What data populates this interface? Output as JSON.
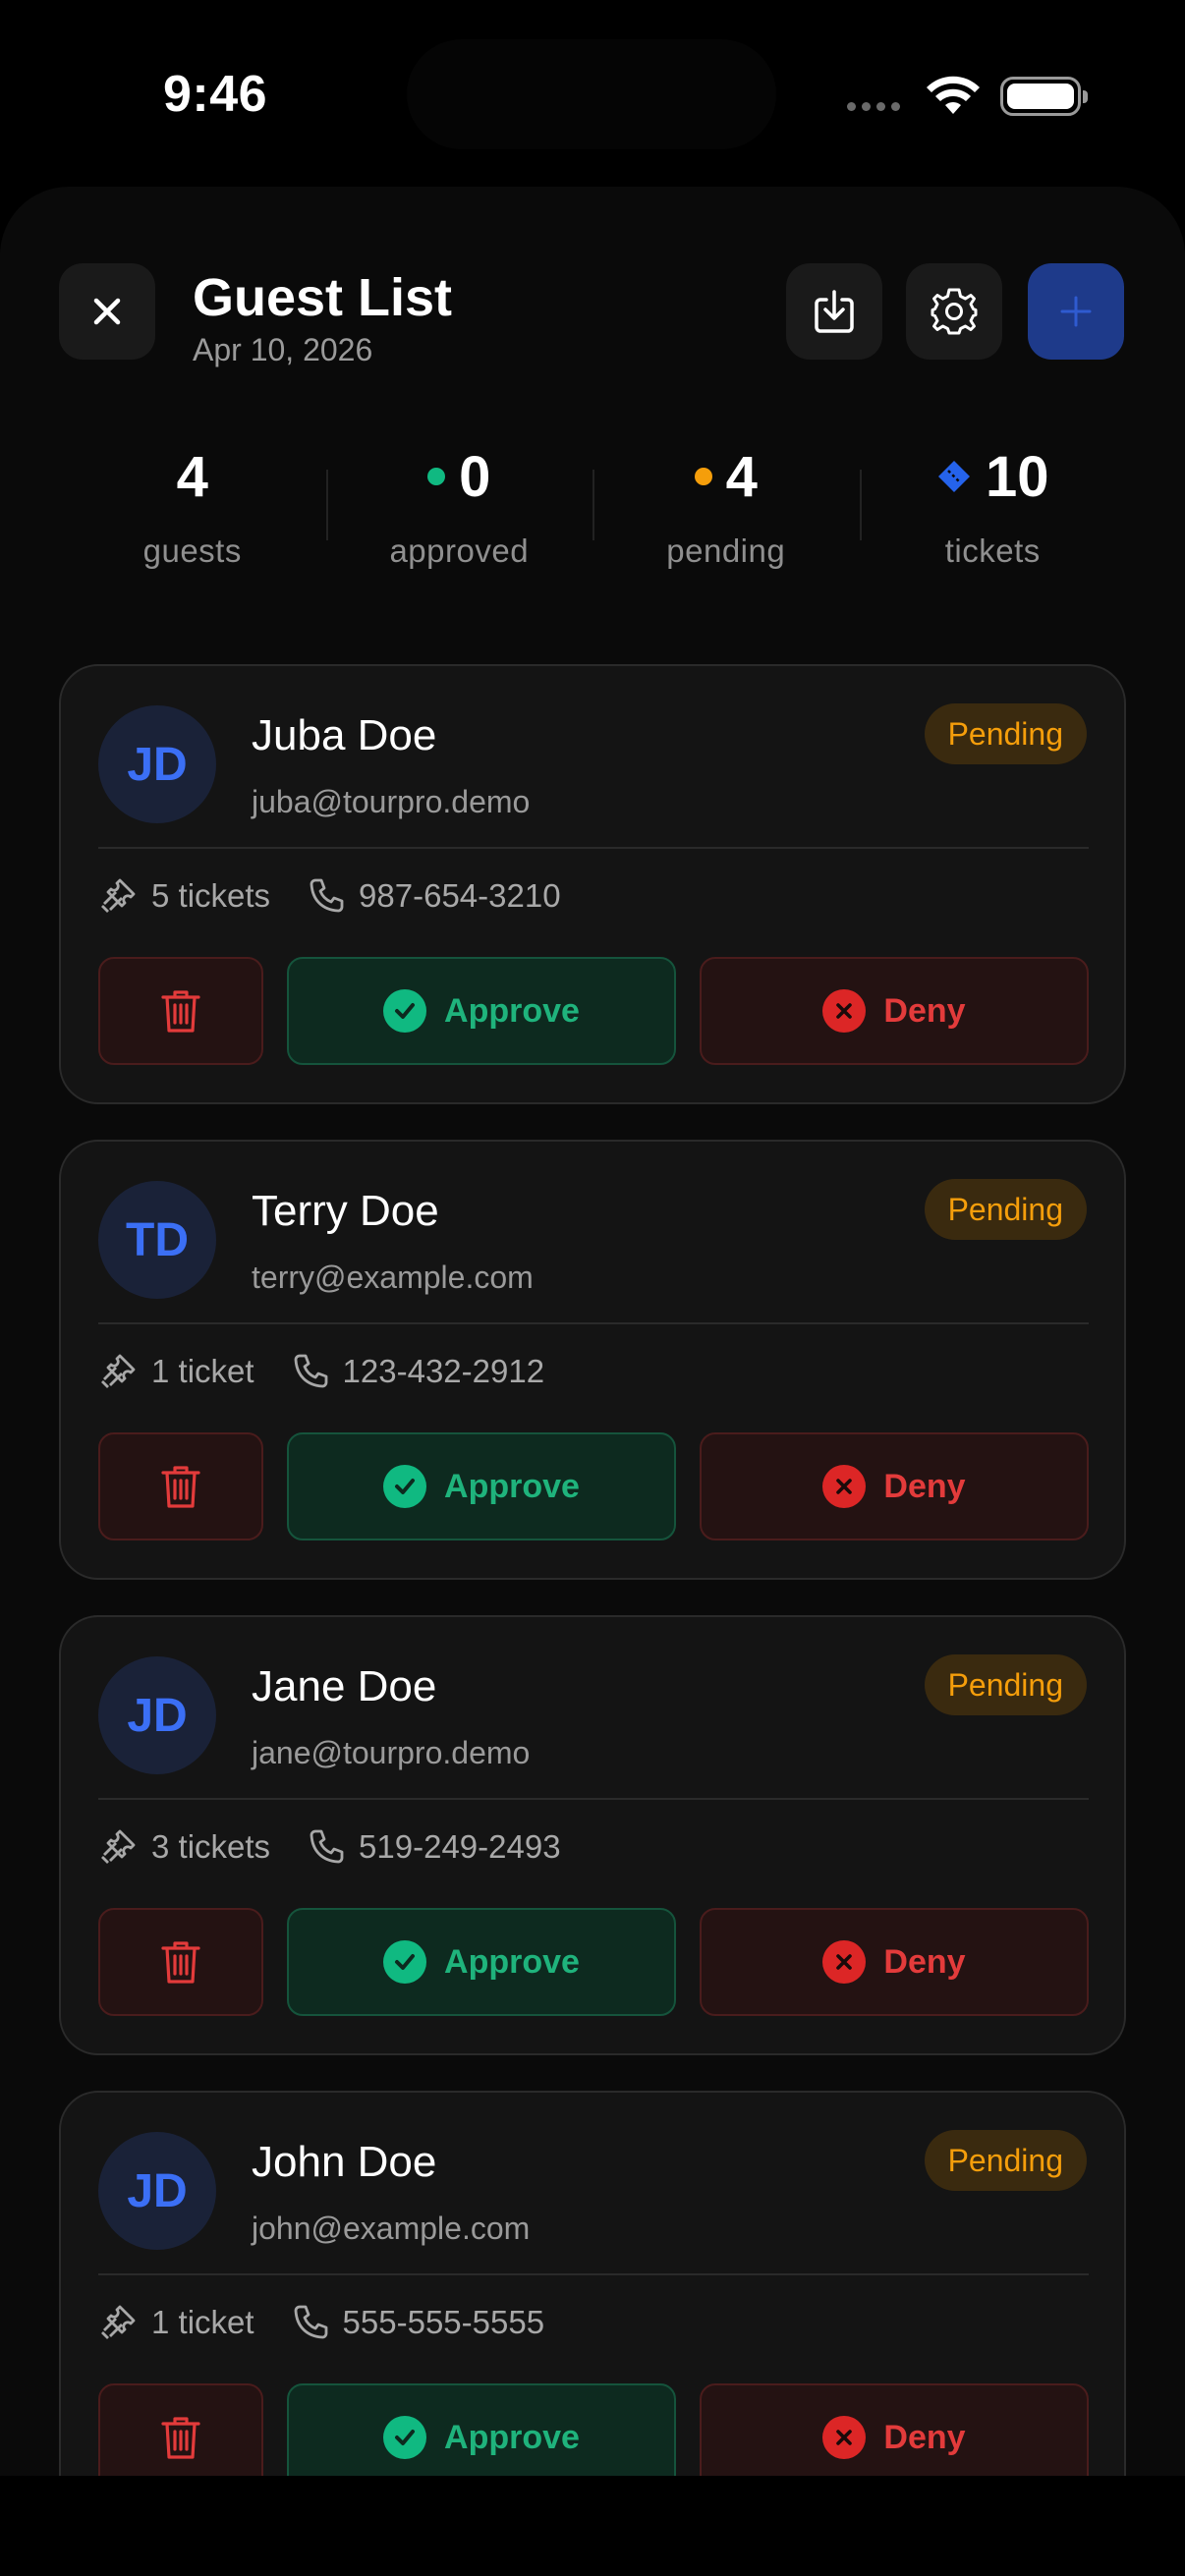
{
  "status_bar": {
    "time": "9:46"
  },
  "header": {
    "title": "Guest List",
    "date": "Apr 10, 2026",
    "close_icon": "close-icon",
    "export_icon": "download-icon",
    "settings_icon": "gear-icon",
    "add_icon": "plus-icon"
  },
  "stats": {
    "guests": {
      "value": "4",
      "label": "guests"
    },
    "approved": {
      "value": "0",
      "label": "approved",
      "color": "#10b981"
    },
    "pending": {
      "value": "4",
      "label": "pending",
      "color": "#f59e0b"
    },
    "tickets": {
      "value": "10",
      "label": "tickets",
      "color": "#2563eb"
    }
  },
  "actions": {
    "approve": "Approve",
    "deny": "Deny"
  },
  "guests": [
    {
      "initials": "JD",
      "name": "Juba Doe",
      "email": "juba@tourpro.demo",
      "status": "Pending",
      "tickets": "5 tickets",
      "phone": "987-654-3210"
    },
    {
      "initials": "TD",
      "name": "Terry Doe",
      "email": "terry@example.com",
      "status": "Pending",
      "tickets": "1 ticket",
      "phone": "123-432-2912"
    },
    {
      "initials": "JD",
      "name": "Jane Doe",
      "email": "jane@tourpro.demo",
      "status": "Pending",
      "tickets": "3 tickets",
      "phone": "519-249-2493"
    },
    {
      "initials": "JD",
      "name": "John Doe",
      "email": "john@example.com",
      "status": "Pending",
      "tickets": "1 ticket",
      "phone": "555-555-5555"
    }
  ],
  "colors": {
    "accent": "#2563eb",
    "approve": "#10b981",
    "deny": "#dc2626",
    "pending": "#f59e0b"
  }
}
